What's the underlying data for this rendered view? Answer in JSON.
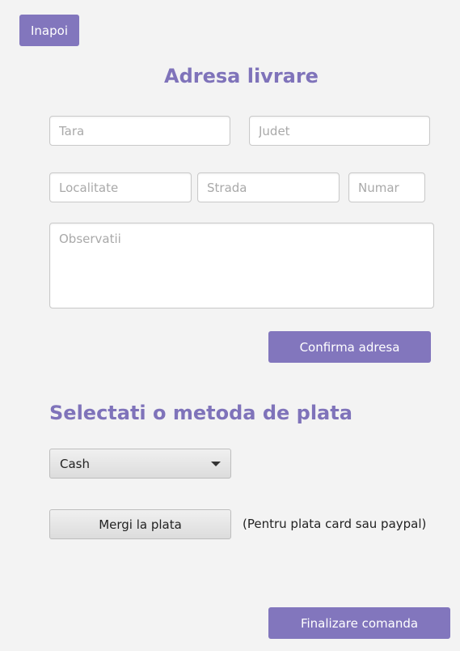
{
  "header": {
    "back_label": "Inapoi"
  },
  "address": {
    "title": "Adresa livrare",
    "tara_placeholder": "Tara",
    "judet_placeholder": "Judet",
    "localitate_placeholder": "Localitate",
    "strada_placeholder": "Strada",
    "numar_placeholder": "Numar",
    "observatii_placeholder": "Observatii",
    "confirm_label": "Confirma adresa"
  },
  "payment": {
    "title": "Selectati o metoda de plata",
    "method_selected": "Cash",
    "go_to_payment_label": "Mergi la plata",
    "note": "(Pentru plata card sau paypal)"
  },
  "footer": {
    "finalize_label": "Finalizare comanda"
  },
  "colors": {
    "accent": "#8276bd",
    "background": "#f3f3f3"
  },
  "icons": {
    "dropdown": "chevron-down-icon"
  }
}
